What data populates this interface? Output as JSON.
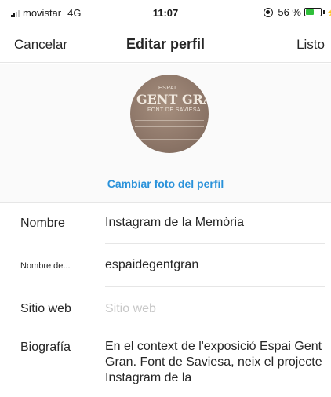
{
  "status_bar": {
    "carrier": "movistar",
    "network": "4G",
    "time": "11:07",
    "battery": "56 %",
    "battery_level": 0.56,
    "battery_color": "#2fbf3a"
  },
  "nav": {
    "cancel_label": "Cancelar",
    "title": "Editar perfil",
    "done_label": "Listo"
  },
  "profile_photo": {
    "change_label": "Cambiar foto del perfil",
    "link_color": "#2a92da"
  },
  "form": {
    "name": {
      "label": "Nombre",
      "value": "Instagram de la Memòria"
    },
    "username": {
      "label": "Nombre de...",
      "value": "espaidegentgran"
    },
    "website": {
      "label": "Sitio web",
      "placeholder": "Sitio web"
    },
    "bio": {
      "label": "Biografía",
      "value": "En el context de l'exposició Espai Gent Gran. Font de Saviesa, neix el projecte Instagram de la"
    }
  }
}
